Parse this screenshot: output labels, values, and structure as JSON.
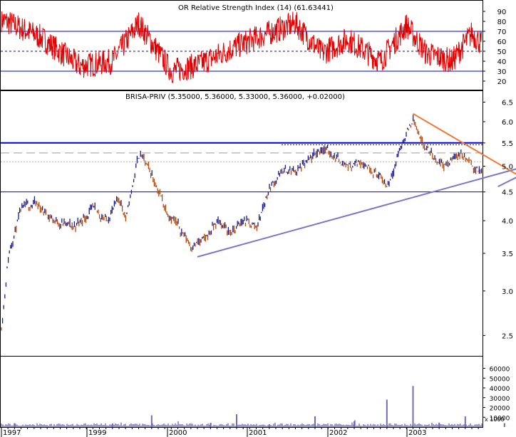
{
  "colors": {
    "rsi_line": "#e00000",
    "price_bar": "#1a1a8c",
    "price_bar_down": "#b04a10",
    "horizontal_levels": "#0000dd",
    "support_trend": "#7878c8",
    "resistance_trend": "#f07830",
    "volume_bar": "#6e6eb8",
    "frame": "#000000"
  },
  "chart_data": [
    {
      "panel": "rsi",
      "type": "line",
      "title": "OR Relative Strength Index (14) (61.63441)",
      "ylim": [
        10,
        100
      ],
      "y_ticks": [
        20,
        30,
        40,
        50,
        60,
        70,
        80,
        90
      ],
      "reference_levels": {
        "upper": 70,
        "middle": 50,
        "lower": 30
      },
      "last_value": 61.63441,
      "series": [
        {
          "x": [
            "1997-01",
            "1997-07",
            "1998-01",
            "1998-06",
            "1998-10",
            "1999-03",
            "1999-07",
            "2000-01",
            "2000-05",
            "2000-10",
            "2001-02",
            "2001-06",
            "2001-11",
            "2002-03",
            "2002-06",
            "2002-10",
            "2003-01",
            "2003-05",
            "2003-09",
            "2003-12"
          ],
          "values": [
            82,
            64,
            35,
            40,
            78,
            30,
            36,
            55,
            66,
            78,
            48,
            62,
            40,
            76,
            48,
            40,
            68,
            40,
            52,
            62
          ]
        }
      ]
    },
    {
      "panel": "price",
      "type": "bar",
      "title": "BRISA-PRIV (5.35000, 5.36000, 5.33000, 5.36000, +0.02000)",
      "scale": "log",
      "ylim": [
        2.3,
        6.8
      ],
      "y_ticks": [
        2.5,
        3.0,
        3.5,
        4.0,
        4.5,
        5.0,
        5.5,
        6.0,
        6.5
      ],
      "last_bar": {
        "open": 5.35,
        "high": 5.36,
        "low": 5.33,
        "close": 5.36,
        "change": 0.02
      },
      "horizontal_levels": [
        5.5,
        4.5
      ],
      "x": [
        "1997-01",
        "1997-02",
        "1997-04",
        "1997-06",
        "1997-09",
        "1997-12",
        "1998-03",
        "1998-05",
        "1998-07",
        "1998-08",
        "1998-10",
        "1998-12",
        "1999-02",
        "1999-04",
        "1999-06",
        "1999-08",
        "1999-10",
        "1999-12",
        "2000-02",
        "2000-04",
        "2000-06",
        "2000-08",
        "2000-10",
        "2000-12",
        "2001-02",
        "2001-04",
        "2001-06",
        "2001-08",
        "2001-10",
        "2001-12",
        "2002-02",
        "2002-04",
        "2002-05",
        "2002-07",
        "2002-09",
        "2002-11",
        "2003-01",
        "2003-03",
        "2003-05",
        "2003-07",
        "2003-09",
        "2003-11",
        "2003-12"
      ],
      "values": [
        2.6,
        3.5,
        4.2,
        4.3,
        4.0,
        3.9,
        4.2,
        4.0,
        4.4,
        4.0,
        5.3,
        4.8,
        4.2,
        3.9,
        3.6,
        3.7,
        4.0,
        3.8,
        4.0,
        3.9,
        4.6,
        4.9,
        4.9,
        5.1,
        5.4,
        5.2,
        5.0,
        5.1,
        4.9,
        4.6,
        5.4,
        6.1,
        5.5,
        5.2,
        5.0,
        5.3,
        5.0,
        4.8,
        4.75,
        4.9,
        5.0,
        5.2,
        5.36
      ],
      "trendlines": [
        {
          "name": "support",
          "from": [
            "1999-07",
            3.45
          ],
          "to": [
            "2003-12",
            5.1
          ]
        },
        {
          "name": "resistance",
          "from": [
            "2002-04",
            6.2
          ],
          "to": [
            "2003-09",
            4.75
          ]
        },
        {
          "name": "short support",
          "from": [
            "2003-05",
            4.6
          ],
          "to": [
            "2003-12",
            5.05
          ]
        }
      ]
    },
    {
      "panel": "volume",
      "type": "bar",
      "y_ticks": [
        10000,
        20000,
        30000,
        40000,
        50000,
        60000
      ],
      "unit_label": "x 1000",
      "x": [
        "1997-03",
        "1998-06",
        "1998-12",
        "1999-09",
        "2000-01",
        "2000-06",
        "2001-01",
        "2001-07",
        "2001-12",
        "2002-04",
        "2002-08",
        "2002-12",
        "2003-06",
        "2003-12"
      ],
      "values": [
        4000,
        3500,
        12000,
        4000,
        13000,
        3000,
        11000,
        6000,
        28000,
        42000,
        4500,
        11000,
        4000,
        5000
      ]
    }
  ],
  "x_axis": {
    "year_labels": [
      "1997",
      "1999",
      "2000",
      "2001",
      "2002",
      "2003"
    ]
  }
}
